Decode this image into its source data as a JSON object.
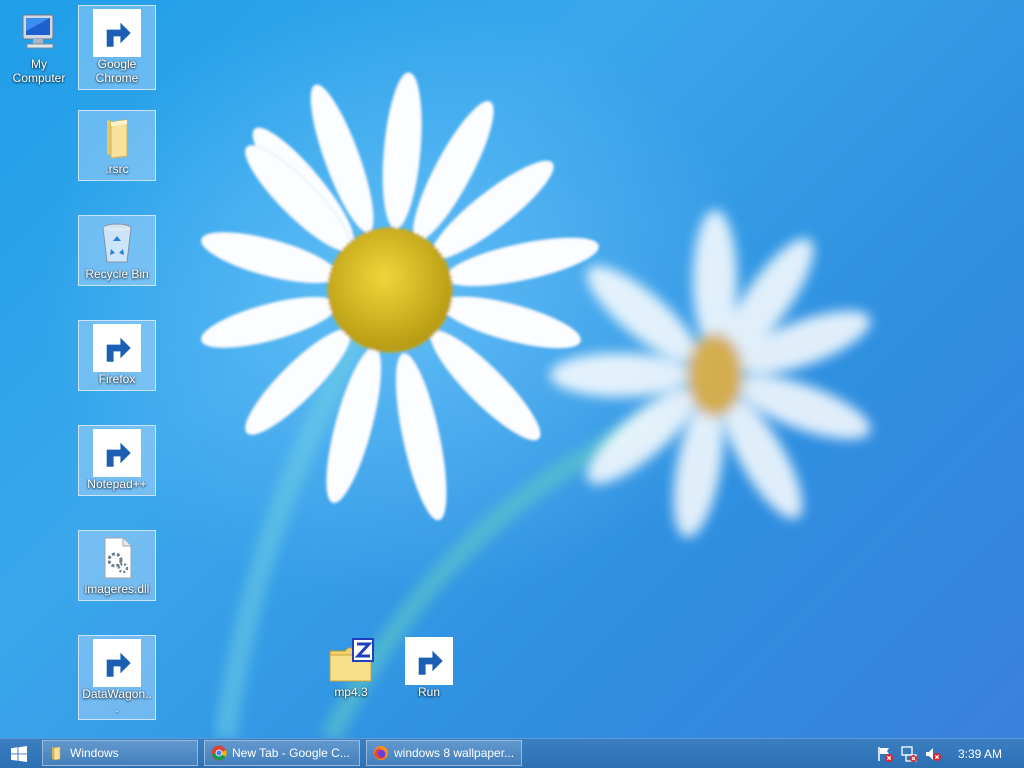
{
  "desktop": {
    "icons": [
      {
        "label": "My Computer",
        "icon": "computer-icon",
        "shortcut": false
      },
      {
        "label": "Google Chrome",
        "icon": "chrome-icon",
        "shortcut": true
      },
      {
        "label": ".rsrc",
        "icon": "folder-icon",
        "shortcut": false
      },
      {
        "label": "Recycle Bin",
        "icon": "recycle-bin-icon",
        "shortcut": false
      },
      {
        "label": "Firefox",
        "icon": "firefox-icon",
        "shortcut": true
      },
      {
        "label": "Notepad++",
        "icon": "notepad-plus-plus-icon",
        "shortcut": true
      },
      {
        "label": "imageres.dll",
        "icon": "dll-file-icon",
        "shortcut": false
      },
      {
        "label": "DataWagon...",
        "icon": "datawagon-icon",
        "shortcut": true
      },
      {
        "label": "mp4.3",
        "icon": "zip-folder-icon",
        "shortcut": false
      },
      {
        "label": "Run",
        "icon": "run-icon",
        "shortcut": true
      }
    ]
  },
  "taskbar": {
    "start_icon": "windows-logo-icon",
    "tasks": [
      {
        "label": "Windows",
        "icon": "folder-icon"
      },
      {
        "label": "New Tab - Google C...",
        "icon": "chrome-icon"
      },
      {
        "label": "windows 8 wallpaper...",
        "icon": "firefox-icon"
      }
    ],
    "tray": {
      "icons": [
        "action-center-flag-icon",
        "network-icon",
        "volume-muted-icon"
      ],
      "clock": "3:39 AM"
    }
  },
  "colors": {
    "desktop_bg": "#2f97e6",
    "taskbar_bg": "#2d6fb3",
    "icon_selection": "#d2e6ff"
  }
}
